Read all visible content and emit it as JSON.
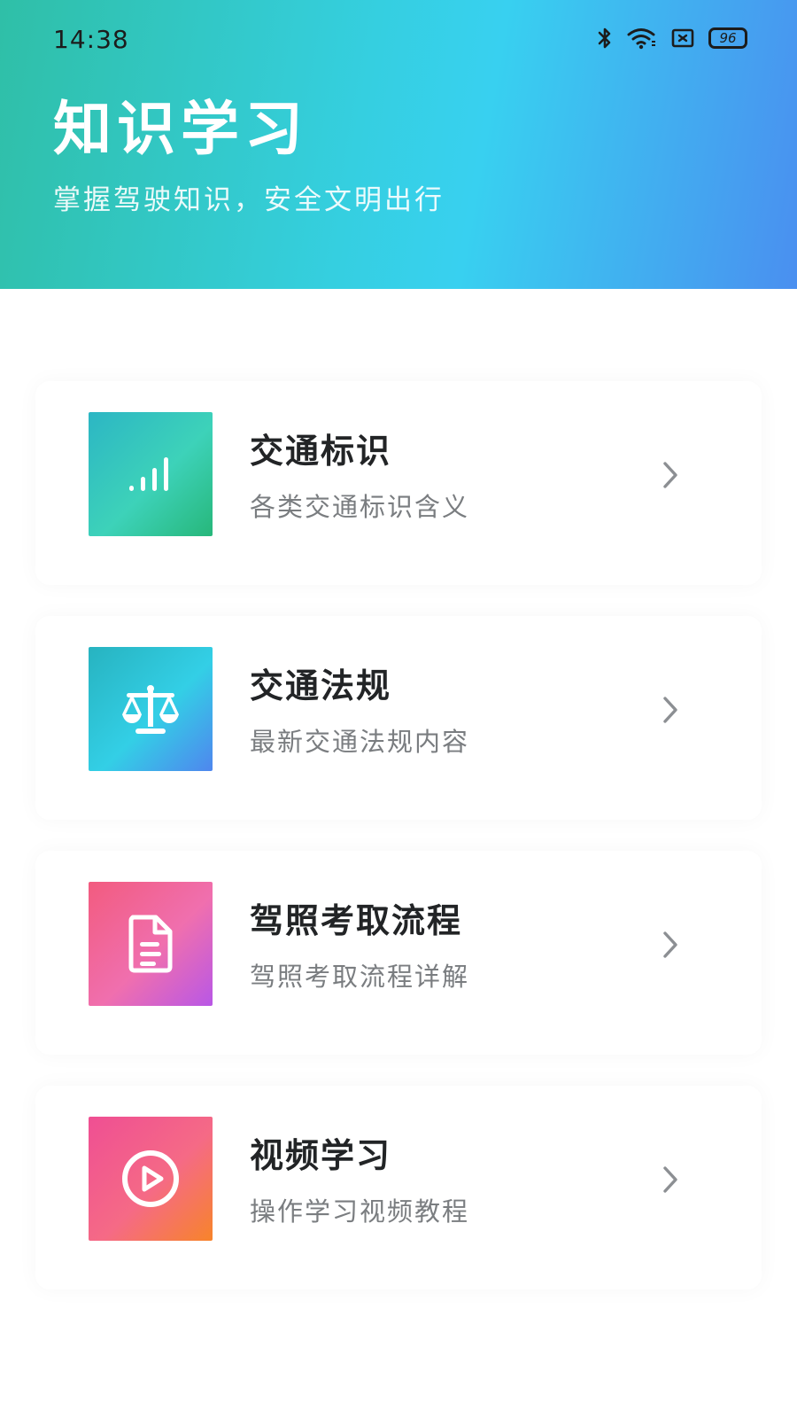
{
  "status_bar": {
    "time": "14:38",
    "battery": "96",
    "icons": [
      "bluetooth-icon",
      "wifi-icon",
      "sim-off-icon",
      "battery-icon"
    ]
  },
  "header": {
    "title": "知识学习",
    "subtitle": "掌握驾驶知识，安全文明出行",
    "gradient_colors": [
      "#2fbfa7",
      "#38d0f0",
      "#4a8ff0"
    ]
  },
  "items": [
    {
      "name": "交通标识",
      "desc": "各类交通标识含义",
      "icon": "signal-bars-icon",
      "colors": [
        "#2cb6c4",
        "#27b77a"
      ]
    },
    {
      "name": "交通法规",
      "desc": "最新交通法规内容",
      "icon": "scale-icon",
      "colors": [
        "#27b3c0",
        "#4f86ee"
      ]
    },
    {
      "name": "驾照考取流程",
      "desc": "驾照考取流程详解",
      "icon": "document-icon",
      "colors": [
        "#f25b7f",
        "#b857e6"
      ]
    },
    {
      "name": "视频学习",
      "desc": "操作学习视频教程",
      "icon": "play-icon",
      "colors": [
        "#ef4f93",
        "#f7842a"
      ]
    }
  ]
}
